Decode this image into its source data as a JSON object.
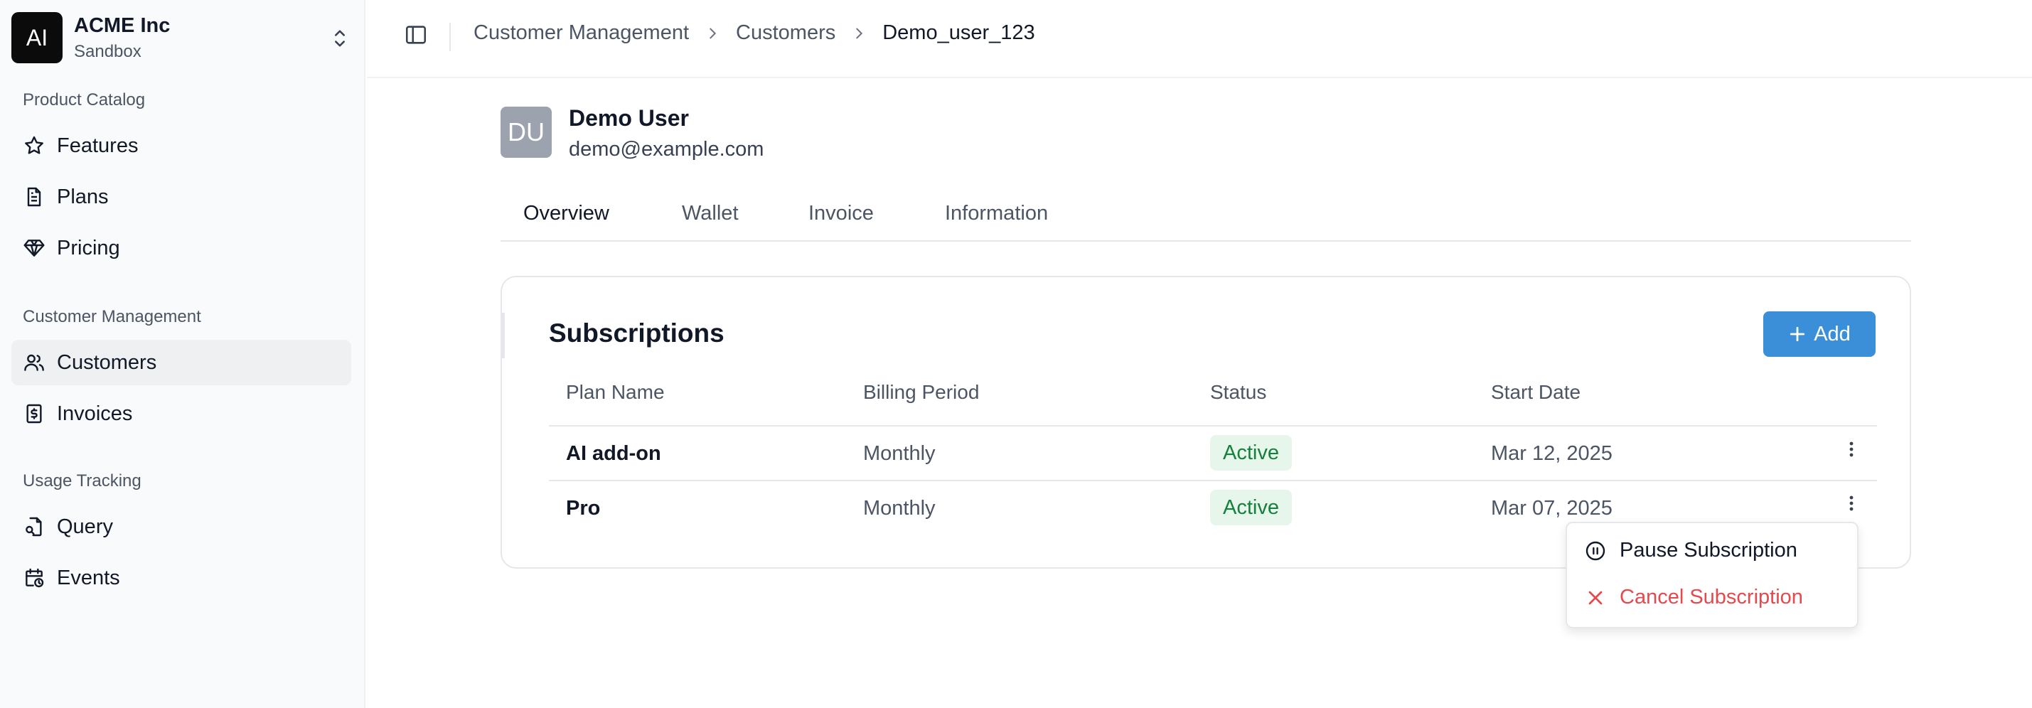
{
  "org": {
    "logo_text": "AI",
    "name": "ACME Inc",
    "environment": "Sandbox"
  },
  "sidebar": {
    "sections": [
      {
        "label": "Product Catalog",
        "items": [
          {
            "label": "Features",
            "icon": "star-icon"
          },
          {
            "label": "Plans",
            "icon": "document-icon"
          },
          {
            "label": "Pricing",
            "icon": "gem-icon"
          }
        ]
      },
      {
        "label": "Customer Management",
        "items": [
          {
            "label": "Customers",
            "icon": "users-icon",
            "active": true
          },
          {
            "label": "Invoices",
            "icon": "receipt-dollar-icon"
          }
        ]
      },
      {
        "label": "Usage Tracking",
        "items": [
          {
            "label": "Query",
            "icon": "query-icon"
          },
          {
            "label": "Events",
            "icon": "calendar-clock-icon"
          }
        ]
      }
    ]
  },
  "breadcrumb": [
    "Customer Management",
    "Customers",
    "Demo_user_123"
  ],
  "customer": {
    "initials": "DU",
    "name": "Demo User",
    "email": "demo@example.com"
  },
  "tabs": [
    "Overview",
    "Wallet",
    "Invoice",
    "Information"
  ],
  "subscriptions": {
    "title": "Subscriptions",
    "add_label": "Add",
    "columns": [
      "Plan Name",
      "Billing Period",
      "Status",
      "Start Date"
    ],
    "rows": [
      {
        "plan": "AI add-on",
        "period": "Monthly",
        "status": "Active",
        "start": "Mar 12, 2025"
      },
      {
        "plan": "Pro",
        "period": "Monthly",
        "status": "Active",
        "start": "Mar 07, 2025"
      }
    ]
  },
  "row_menu": {
    "pause_label": "Pause Subscription",
    "cancel_label": "Cancel Subscription"
  },
  "colors": {
    "accent": "#3b8fd9",
    "active_badge_bg": "#e7f6ea",
    "active_badge_text": "#15803d",
    "danger": "#e5484d"
  }
}
